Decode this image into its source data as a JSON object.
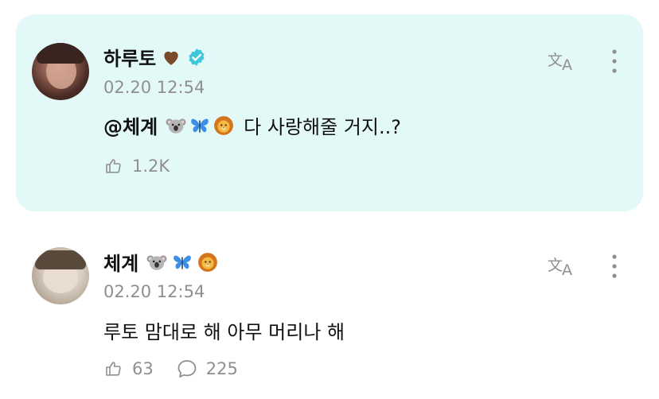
{
  "posts": [
    {
      "author": "하루토",
      "author_suffix_icon": "brown-heart-icon",
      "verified": true,
      "timestamp": "02.20 12:54",
      "mention": "@체계",
      "emojis": [
        "koala-icon",
        "butterfly-icon",
        "lion-icon"
      ],
      "body": "다 사랑해줄 거지..?",
      "likes": "1.2K",
      "highlighted": true
    },
    {
      "author": "체계",
      "author_emojis": [
        "koala-icon",
        "butterfly-icon",
        "lion-icon"
      ],
      "timestamp": "02.20 12:54",
      "body": "루토 맘대로 해 아무 머리나 해",
      "likes": "63",
      "comments": "225",
      "highlighted": false
    }
  ],
  "colors": {
    "highlight_bg": "#e3f9f7",
    "verified": "#3ec7d8",
    "muted": "#8f8f8f"
  }
}
